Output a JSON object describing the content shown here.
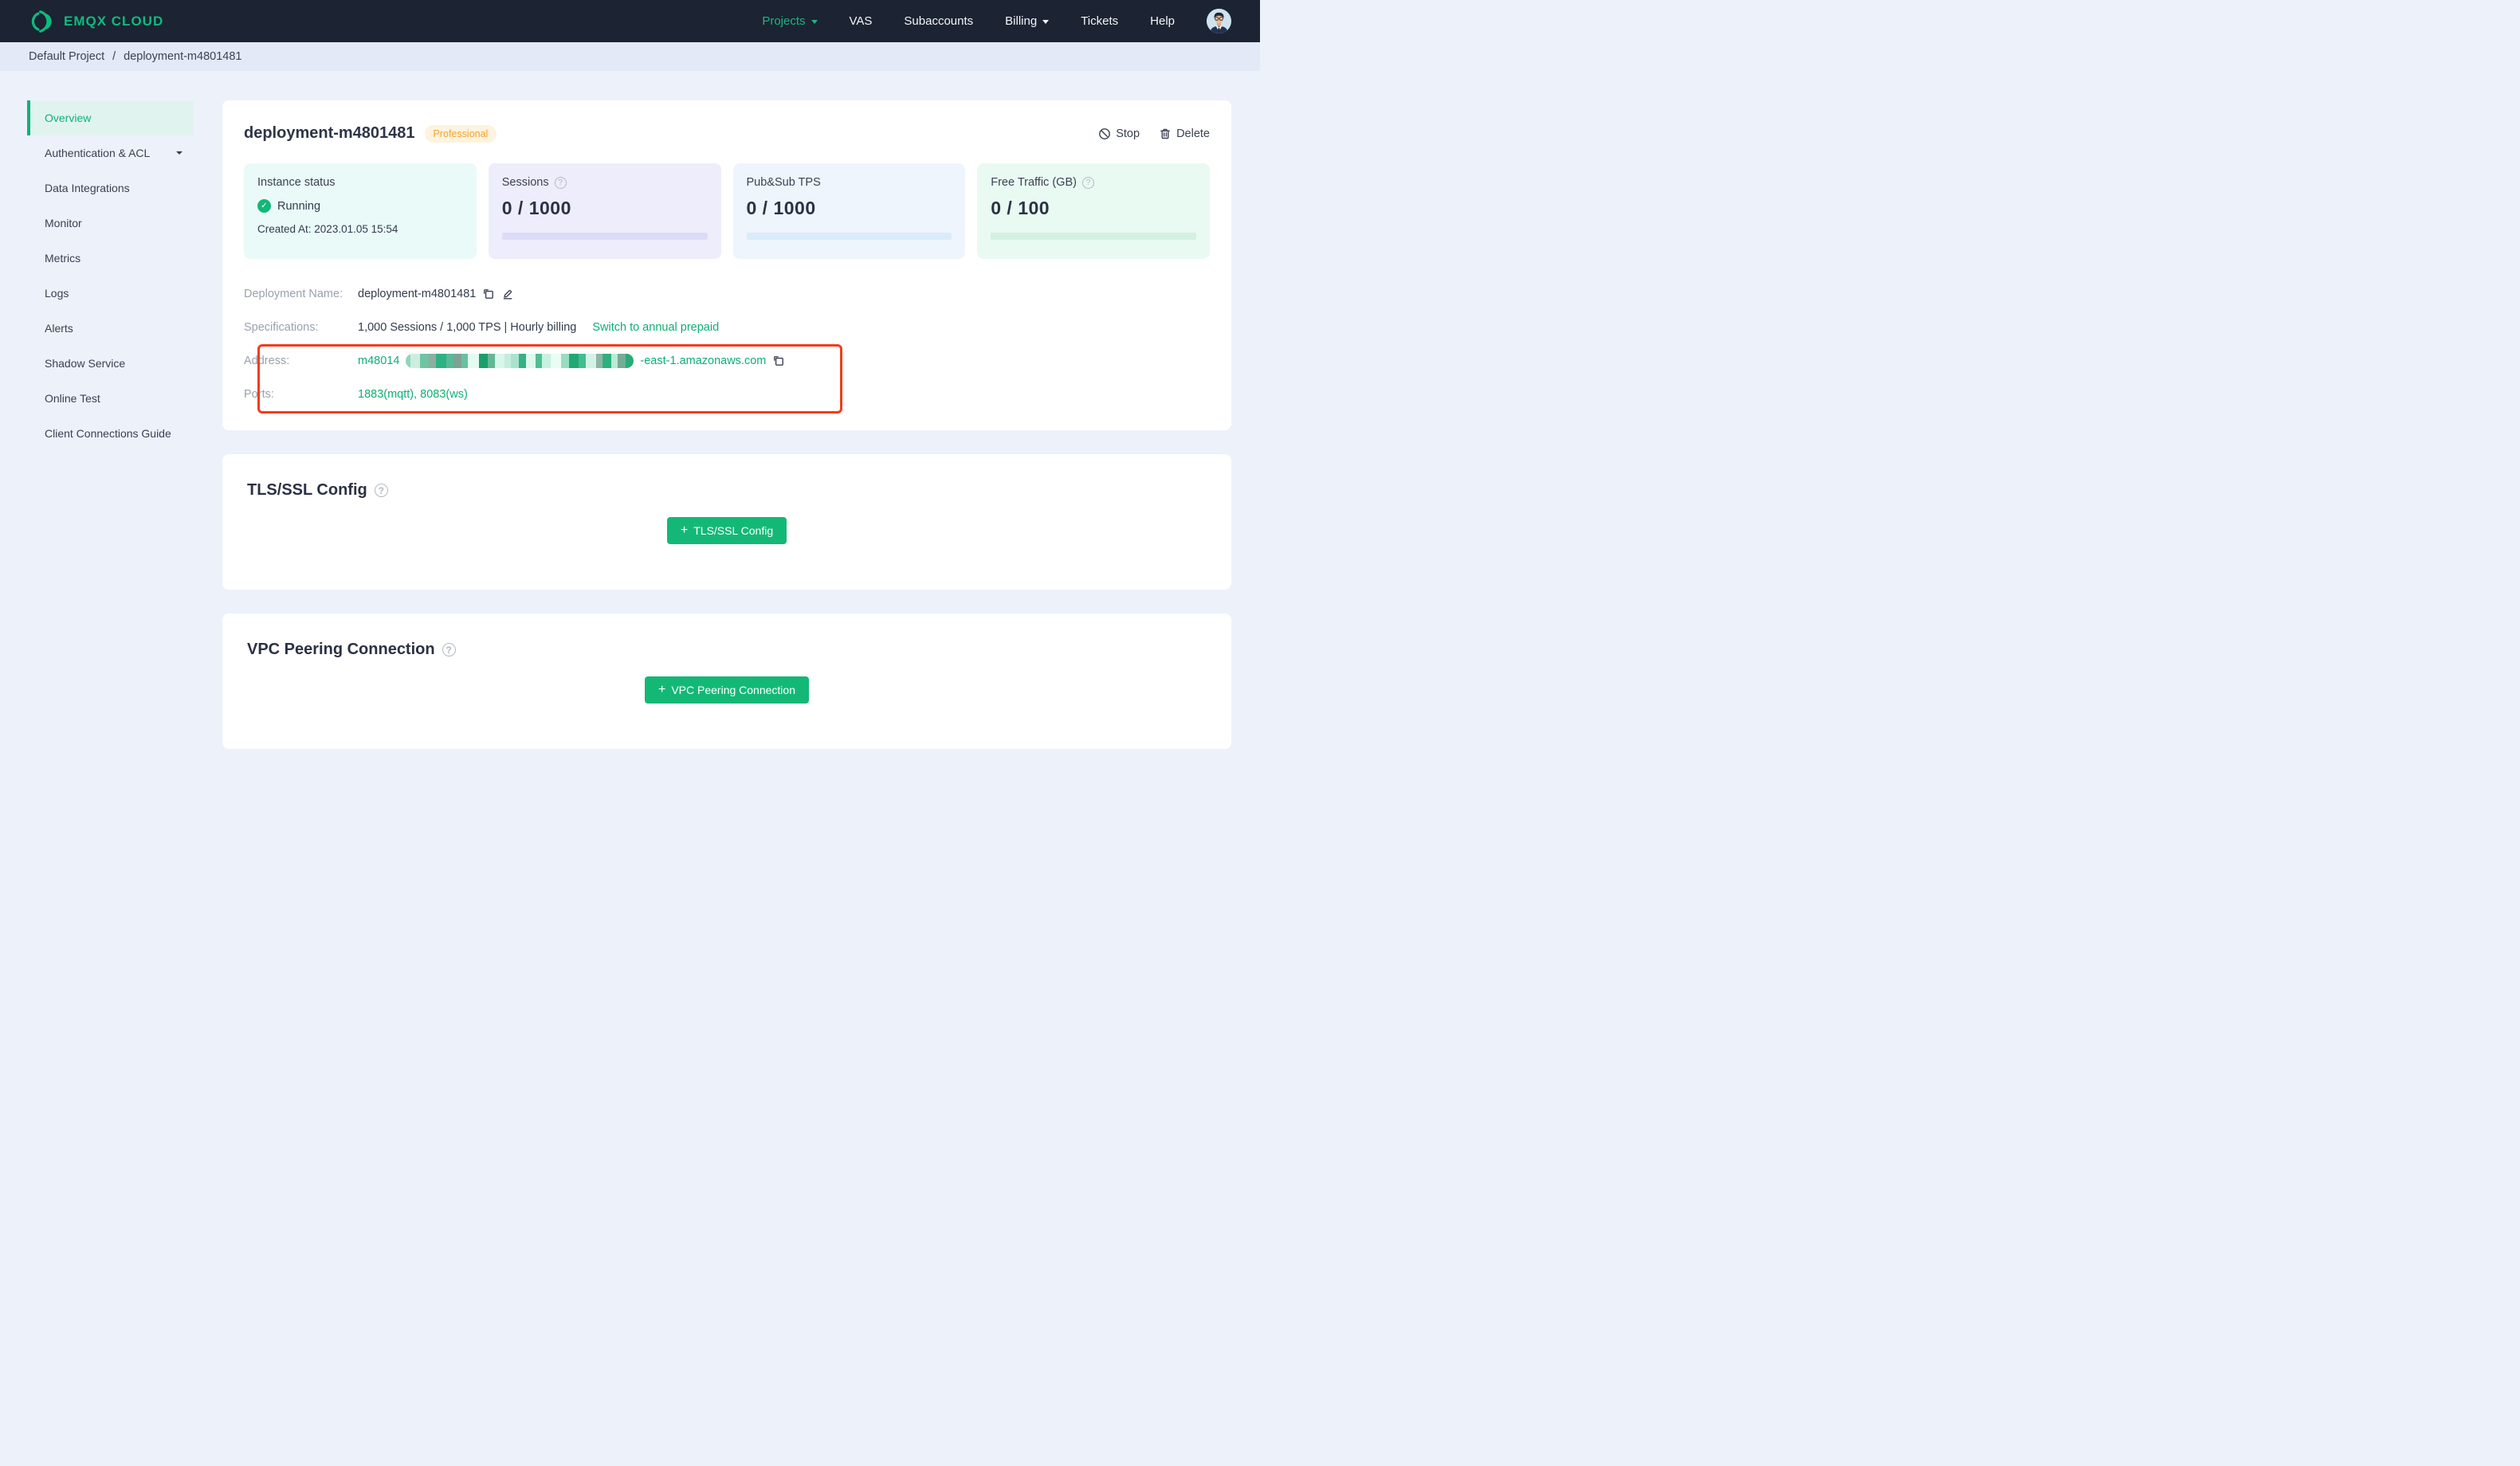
{
  "navbar": {
    "brand": "EMQX CLOUD",
    "items": [
      {
        "label": "Projects",
        "active": true,
        "has_caret": true
      },
      {
        "label": "VAS"
      },
      {
        "label": "Subaccounts"
      },
      {
        "label": "Billing",
        "has_caret": true
      },
      {
        "label": "Tickets"
      },
      {
        "label": "Help"
      }
    ],
    "colors": {
      "bg": "#1c2332",
      "active_green": "#1db581",
      "text": "#f3f5f8"
    }
  },
  "breadcrumb": {
    "project": "Default Project",
    "separator": "/",
    "current": "deployment-m4801481"
  },
  "sidebar": {
    "items": [
      {
        "label": "Overview",
        "active": true
      },
      {
        "label": "Authentication & ACL",
        "has_caret": true
      },
      {
        "label": "Data Integrations"
      },
      {
        "label": "Monitor"
      },
      {
        "label": "Metrics"
      },
      {
        "label": "Logs"
      },
      {
        "label": "Alerts"
      },
      {
        "label": "Shadow Service"
      },
      {
        "label": "Online Test"
      },
      {
        "label": "Client Connections Guide"
      }
    ],
    "active_color": "#0db179"
  },
  "overview": {
    "title": "deployment-m4801481",
    "badge": "Professional",
    "actions": {
      "stop": "Stop",
      "delete": "Delete"
    },
    "stats": [
      {
        "label": "Instance status",
        "status": "Running",
        "created": "Created At: 2023.01.05 15:54",
        "bg": "#eafaf8"
      },
      {
        "label": "Sessions",
        "value": "0 / 1000",
        "has_help": true,
        "bg": "#ededfb",
        "bar": "#dcdcf8"
      },
      {
        "label": "Pub&Sub TPS",
        "value": "0 / 1000",
        "bg": "#eef5fd",
        "bar": "#d8ecfa"
      },
      {
        "label": "Free Traffic (GB)",
        "value": "0 / 100",
        "has_help": true,
        "bg": "#e9faf2",
        "bar": "#d3f1e2"
      }
    ],
    "info": {
      "deployment_name_label": "Deployment Name:",
      "deployment_name": "deployment-m4801481",
      "specifications_label": "Specifications:",
      "specifications": "1,000 Sessions / 1,000 TPS | Hourly billing",
      "specifications_link": "Switch to annual prepaid",
      "address_label": "Address:",
      "address_prefix": "m48014",
      "address_suffix": "-east-1.amazonaws.com",
      "ports_label": "Ports:",
      "ports": "1883(mqtt), 8083(ws)"
    },
    "annotation_color": "#f43b1c",
    "redaction_mosaic": [
      {
        "w": 6,
        "c": "#8fd6bd"
      },
      {
        "w": 12,
        "c": "#cdeedd"
      },
      {
        "w": 11,
        "c": "#6fc4a4"
      },
      {
        "w": 9,
        "c": "#8fae9f"
      },
      {
        "w": 13,
        "c": "#2cb381"
      },
      {
        "w": 10,
        "c": "#57bb95"
      },
      {
        "w": 9,
        "c": "#7fa193"
      },
      {
        "w": 8,
        "c": "#69c0a0"
      },
      {
        "w": 14,
        "c": "#e4fbf2"
      },
      {
        "w": 11,
        "c": "#1b9e6b"
      },
      {
        "w": 9,
        "c": "#64b795"
      },
      {
        "w": 12,
        "c": "#d9f6ea"
      },
      {
        "w": 8,
        "c": "#c3eedd"
      },
      {
        "w": 10,
        "c": "#abe2cc"
      },
      {
        "w": 9,
        "c": "#35b184"
      },
      {
        "w": 12,
        "c": "#dff8ee"
      },
      {
        "w": 8,
        "c": "#4fbf93"
      },
      {
        "w": 11,
        "c": "#c9f1e1"
      },
      {
        "w": 13,
        "c": "#e8fdf5"
      },
      {
        "w": 10,
        "c": "#9adcc3"
      },
      {
        "w": 12,
        "c": "#21a873"
      },
      {
        "w": 9,
        "c": "#43bd90"
      },
      {
        "w": 13,
        "c": "#d2f3e5"
      },
      {
        "w": 8,
        "c": "#8fb5a6"
      },
      {
        "w": 11,
        "c": "#2eb07c"
      },
      {
        "w": 8,
        "c": "#bde9d6"
      },
      {
        "w": 10,
        "c": "#74ac97"
      },
      {
        "w": 10,
        "c": "#29ab77"
      }
    ]
  },
  "tls_section": {
    "title": "TLS/SSL Config",
    "button": "TLS/SSL Config"
  },
  "vpc_section": {
    "title": "VPC Peering Connection",
    "button": "VPC Peering Connection"
  },
  "brand_colors": {
    "green": "#0fba7d",
    "button_green": "#13b877",
    "link_green": "#0fae74"
  }
}
